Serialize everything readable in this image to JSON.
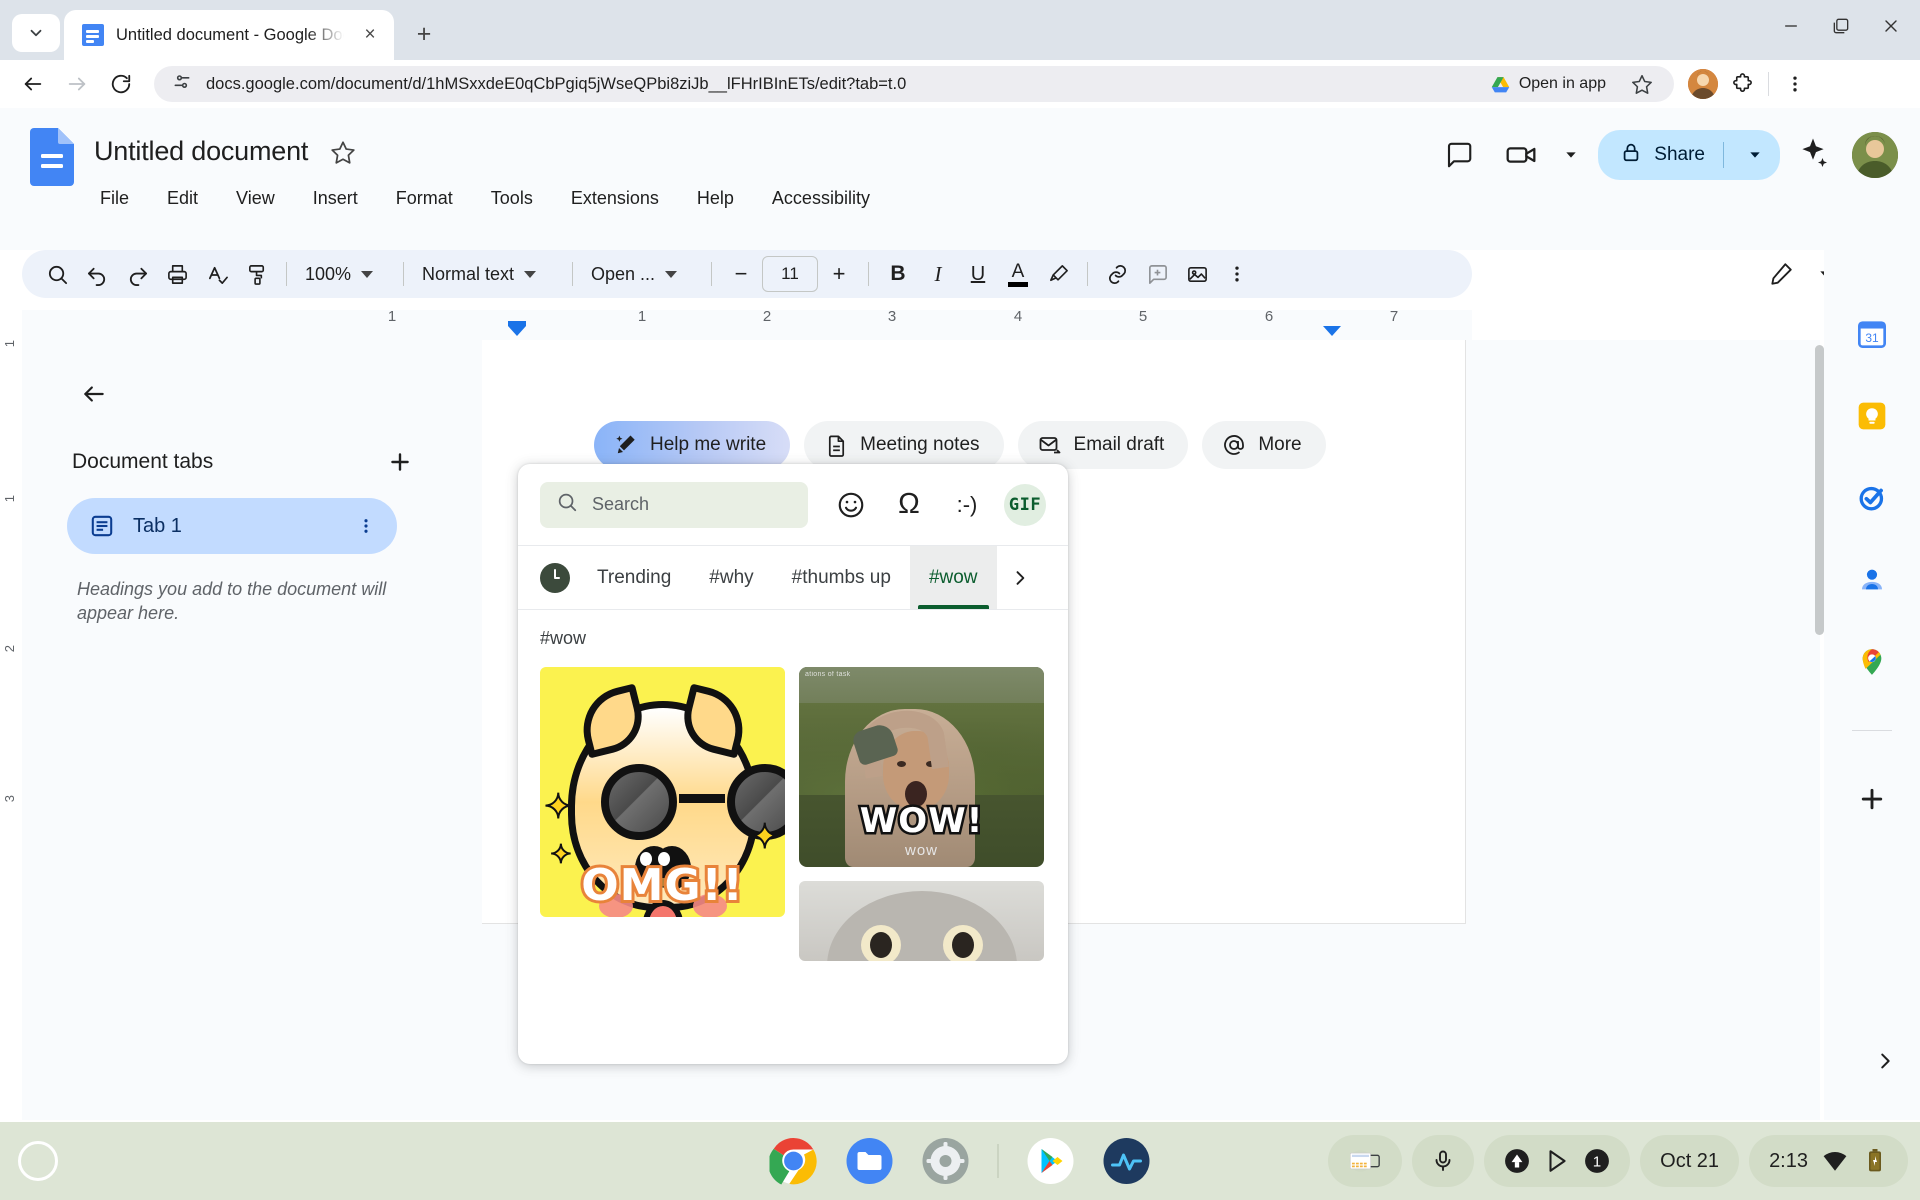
{
  "browser": {
    "tab": {
      "title": "Untitled document - Google Doc",
      "favicon": "google-docs-icon",
      "close": "×",
      "new_tab": "+"
    },
    "tabstrip_chevron": "chevron-down-icon",
    "window_controls": {
      "minimize": "—",
      "maximize": "❐",
      "close": "✕"
    },
    "omnibox": {
      "url": "docs.google.com/document/d/1hMSxxdeE0qCbPgiq5jWseQPbi8ziJb__lFHrIBInETs/edit?tab=t.0",
      "site_info_icon": "site-settings-icon",
      "open_in_app": "Open in app",
      "bookmark_icon": "star-icon",
      "extensions_icon": "extensions-icon",
      "menu_icon": "three-dot-menu-icon"
    },
    "nav": {
      "back": "back-arrow-icon",
      "forward": "forward-arrow-icon",
      "reload": "reload-icon"
    }
  },
  "docs": {
    "title": "Untitled document",
    "star": "star-icon",
    "menus": [
      "File",
      "Edit",
      "View",
      "Insert",
      "Format",
      "Tools",
      "Extensions",
      "Help",
      "Accessibility"
    ],
    "header_actions": {
      "comments": "comment-icon",
      "meet": "video-camera-icon",
      "meet_caret": "chevron-down-icon",
      "share_label": "Share",
      "share_lock": "lock-icon",
      "share_caret": "chevron-down-icon",
      "gemini": "gemini-spark-icon",
      "avatar": "user-avatar"
    },
    "toolbar": {
      "search": "search-icon",
      "undo": "undo-icon",
      "redo": "redo-icon",
      "print": "print-icon",
      "spelling": "spellcheck-icon",
      "paint_format": "paint-format-icon",
      "zoom": "100%",
      "style": "Normal text",
      "font": "Open ...",
      "font_decrease": "−",
      "font_size": "11",
      "font_increase": "+",
      "bold": "B",
      "italic": "I",
      "underline": "U",
      "text_color": "A",
      "highlight": "highlight-pen-icon",
      "link": "link-icon",
      "comment": "add-comment-icon",
      "image": "insert-image-icon",
      "more": "more-options-icon",
      "editing_mode": "pencil-icon",
      "editing_caret": "chevron-down-icon",
      "collapse": "chevron-up-icon"
    },
    "ruler": {
      "marks": [
        "1",
        "1",
        "2",
        "3",
        "4",
        "5",
        "6",
        "7"
      ],
      "vertical_marks": [
        "1",
        "1",
        "2",
        "3"
      ]
    },
    "tabs_panel": {
      "back": "back-arrow-icon",
      "heading": "Document tabs",
      "add": "add-tab-icon",
      "tab_icon": "document-tab-icon",
      "tab_label": "Tab 1",
      "tab_more": "three-dot-menu-icon",
      "hint": "Headings you add to the document will appear here."
    },
    "chips": [
      {
        "label": "Help me write",
        "icon": "magic-pencil-icon",
        "active": true
      },
      {
        "label": "Meeting notes",
        "icon": "document-icon",
        "active": false
      },
      {
        "label": "Email draft",
        "icon": "email-send-icon",
        "active": false
      },
      {
        "label": "More",
        "icon": "at-sign-icon",
        "active": false
      }
    ],
    "rail": [
      {
        "name": "google-keep-icon"
      },
      {
        "name": "google-tasks-icon"
      },
      {
        "name": "google-contacts-icon"
      },
      {
        "name": "google-maps-icon"
      },
      {
        "name": "add-on-plus-icon"
      }
    ],
    "rail_expand": "expand-panel-icon"
  },
  "picker": {
    "search_placeholder": "Search",
    "search_icon": "search-icon",
    "tools": [
      {
        "name": "emoji-icon",
        "label": "☺"
      },
      {
        "name": "special-character-icon",
        "label": "Ω"
      },
      {
        "name": "emoticon-icon",
        "label": ":-)"
      },
      {
        "name": "gif-icon",
        "label": "GIF",
        "active": true
      }
    ],
    "categories": [
      {
        "label": "recent-clock-icon",
        "icon": true
      },
      {
        "label": "Trending",
        "active": false
      },
      {
        "label": "#why",
        "active": false
      },
      {
        "label": "#thumbs up",
        "active": false
      },
      {
        "label": "#wow",
        "active": true
      }
    ],
    "next_arrow": "chevron-right-icon",
    "result_label": "#wow",
    "results": [
      {
        "name": "kawaii-cat-omg-gif",
        "caption": "OMG!!"
      },
      {
        "name": "wow-reaction-gif",
        "caption": "WOW!",
        "subcaption": "wow",
        "watermark": "ations of task"
      },
      {
        "name": "grey-cat-gif",
        "caption": ""
      }
    ]
  },
  "shelf": {
    "launcher": "launcher-icon",
    "apps": [
      {
        "name": "chrome-icon"
      },
      {
        "name": "files-icon"
      },
      {
        "name": "settings-icon"
      },
      {
        "name": "play-store-icon"
      },
      {
        "name": "activity-icon"
      }
    ],
    "tray": {
      "ime_icon": "keyboard-icon",
      "mic_icon": "microphone-icon",
      "status_icons": [
        "updates-icon",
        "play-store-icon",
        "notification-count-icon"
      ],
      "notification_count": "1",
      "date": "Oct 21",
      "time": "2:13",
      "wifi_icon": "wifi-icon",
      "battery_icon": "battery-icon"
    }
  },
  "colors": {
    "chrome_tabstrip": "#dde3ea",
    "docs_bg": "#f9fbfd",
    "toolbar_bg": "#edf2fa",
    "accent_blue": "#1a73e8",
    "share_bg": "#c2e7ff",
    "tab_selected": "#c2dbff",
    "picker_green": "#0b5d2e",
    "shelf_bg": "#dde5d5"
  }
}
